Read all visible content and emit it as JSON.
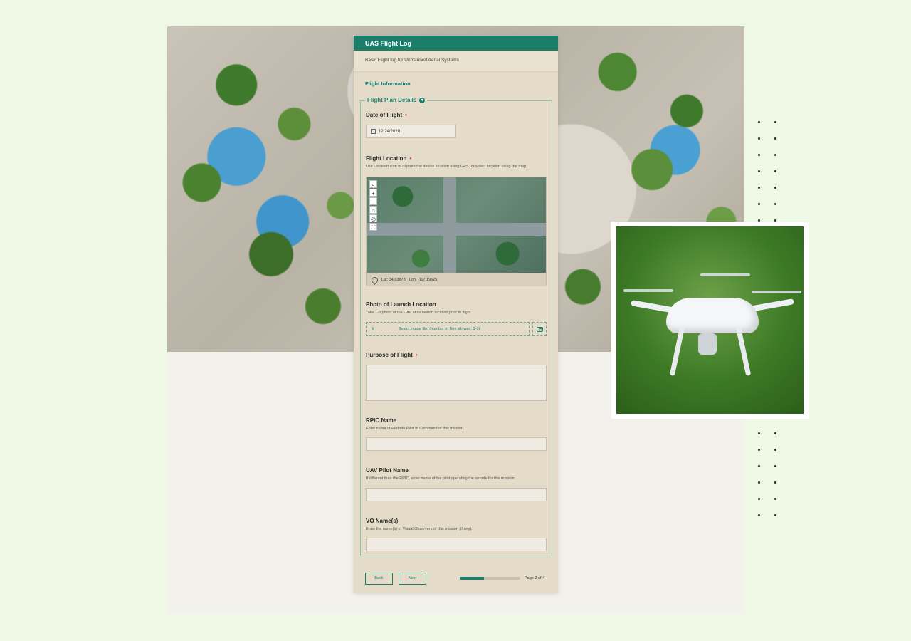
{
  "form": {
    "title": "UAS Flight Log",
    "description": "Basic Flight log for Unmanned Aerial Systems",
    "section": "Flight Information",
    "group_title": "Flight Plan Details",
    "date": {
      "label": "Date of Flight",
      "value": "12/24/2020",
      "required": "•"
    },
    "location": {
      "label": "Flight Location",
      "required": "•",
      "hint": "Use Location icon to capture the device location using GPS, or select location using the map.",
      "lat": "Lat: 34.03878",
      "lon": "Lon: -117.19625",
      "tools": [
        "search-icon",
        "zoom-in-icon",
        "zoom-out-icon",
        "home-icon",
        "locate-icon",
        "fullscreen-icon"
      ]
    },
    "photo": {
      "label": "Photo of Launch Location",
      "hint": "Take 1-3 photo of the UAV at its launch location prior to flight.",
      "count": "1",
      "prompt": "Select image file. (number of files allowed: 1-3)"
    },
    "purpose": {
      "label": "Purpose of Flight",
      "required": "•",
      "value": ""
    },
    "rpic": {
      "label": "RPIC Name",
      "hint": "Enter name of Remote Pilot In Command of this mission.",
      "value": ""
    },
    "uav_pilot": {
      "label": "UAV Pilot Name",
      "hint": "If different than the RPIC, enter name of the pilot operating the remote for this mission.",
      "value": ""
    },
    "vo": {
      "label": "VO Name(s)",
      "hint": "Enter the name(s) of Visual Observers of this mission (if any).",
      "value": ""
    },
    "footer": {
      "back": "Back",
      "next": "Next",
      "page": "Page 2 of 4",
      "progress": 0.4
    }
  },
  "colors": {
    "accent": "#1a7e6b",
    "card": "#e4dcc9",
    "required": "#c84b32"
  }
}
